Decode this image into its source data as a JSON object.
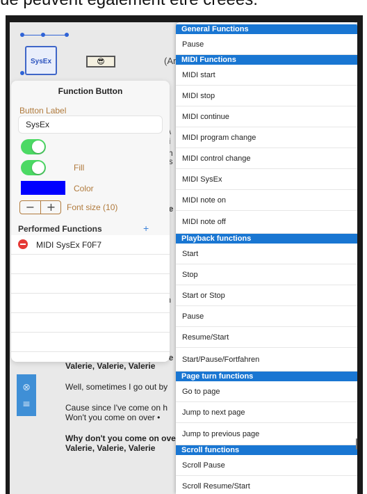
{
  "caption": "ue peuvent également être créées.",
  "canvas": {
    "sysex_button": "SysEx",
    "emoji_button": "😎",
    "partial_text": "(Ar"
  },
  "song_lines": [
    "Valerie, Valerie, Valerie",
    "Well, sometimes I go out by",
    "Cause since I've come on h",
    "Won't you come on over • ",
    "Why don't you come on ove",
    "Valerie, Valerie, Valerie"
  ],
  "peek_letters": [
    "y",
    "r",
    ", \\",
    "oi",
    "i",
    "h",
    "es",
    "r",
    "e",
    "- ",
    "ve",
    "•",
    "r",
    "r",
    "th",
    "•",
    "r",
    "S",
    "ve"
  ],
  "panel": {
    "title": "Function Button",
    "button_label_caption": "Button Label",
    "button_label_value": "SysEx",
    "fill_label": "Fill",
    "color_label": "Color",
    "color_value": "#0000ff",
    "stepper_minus": "−",
    "stepper_plus": "+",
    "font_size_label": "Font size (10)",
    "performed_title": "Performed Functions",
    "add_symbol": "+",
    "performed_items": [
      "MIDI SysEx F0F7"
    ]
  },
  "strip_icons": [
    "close-circle-icon",
    "menu-lines-icon"
  ],
  "menu": {
    "sec_general": "General Functions",
    "general": [
      "Pause"
    ],
    "sec_midi": "MIDI Functions",
    "midi": [
      "MIDI start",
      "MIDI stop",
      "MIDI continue",
      "MIDI program change",
      "MIDI control change",
      "MIDI SysEx",
      "MIDI note on",
      "MIDI note off"
    ],
    "sec_playback": "Playback functions",
    "playback": [
      "Start",
      "Stop",
      "Start or Stop",
      "Pause",
      "Resume/Start",
      "Start/Pause/Fortfahren"
    ],
    "sec_page": "Page turn functions",
    "page": [
      "Go to page",
      "Jump to next page",
      "Jump to previous page"
    ],
    "sec_scroll": "Scroll functions",
    "scroll": [
      "Scroll Pause",
      "Scroll Resume/Start"
    ]
  }
}
